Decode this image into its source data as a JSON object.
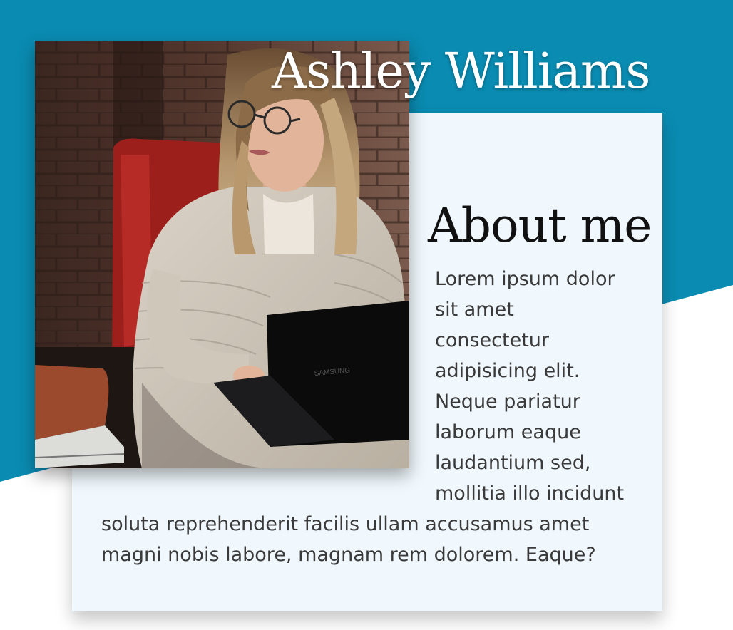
{
  "profile": {
    "name": "Ashley Williams",
    "photo_alt": "woman with glasses working on laptop"
  },
  "about": {
    "heading": "About me",
    "lines": [
      "Lorem ipsum dolor",
      "sit amet",
      "consectetur",
      "adipisicing elit.",
      "Neque pariatur",
      "laborum eaque",
      "laudantium sed,",
      "mollitia illo incidunt",
      "soluta reprehenderit facilis ullam accusamus amet",
      "magni nobis labore, magnam rem dolorem. Eaque?"
    ]
  },
  "colors": {
    "accent": "#0a8bb1",
    "card": "#f0f8fd",
    "text": "#3a3a3a",
    "heading": "#111111"
  }
}
